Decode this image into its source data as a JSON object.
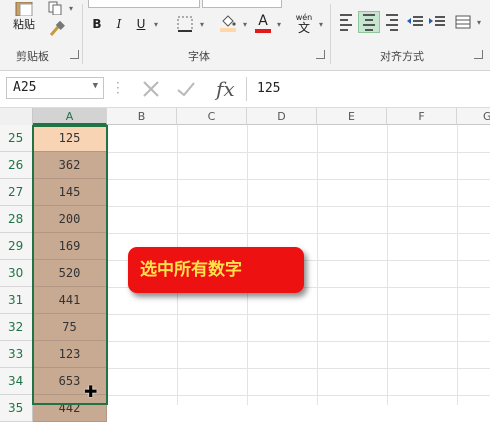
{
  "ribbon": {
    "clipboard": {
      "paste_label": "粘贴",
      "group_label": "剪贴板"
    },
    "font": {
      "bold": "B",
      "italic": "I",
      "underline": "U",
      "font_color_letter": "A",
      "phonetic_top": "wén",
      "phonetic_bottom": "文",
      "group_label": "字体"
    },
    "alignment": {
      "group_label": "对齐方式"
    }
  },
  "formula_bar": {
    "name_box": "A25",
    "formula": "125",
    "fx_label": "fx"
  },
  "sheet": {
    "columns": [
      "A",
      "B",
      "C",
      "D",
      "E",
      "F",
      "G"
    ],
    "selected_column": "A",
    "rows": [
      {
        "num": "25",
        "a": "125"
      },
      {
        "num": "26",
        "a": "362"
      },
      {
        "num": "27",
        "a": "145"
      },
      {
        "num": "28",
        "a": "200"
      },
      {
        "num": "29",
        "a": "169"
      },
      {
        "num": "30",
        "a": "520"
      },
      {
        "num": "31",
        "a": "441"
      },
      {
        "num": "32",
        "a": "75"
      },
      {
        "num": "33",
        "a": "123"
      },
      {
        "num": "34",
        "a": "653"
      },
      {
        "num": "35",
        "a": "442"
      }
    ]
  },
  "callout": {
    "text": "选中所有数字"
  },
  "colors": {
    "selection_fill": "#c8a992",
    "active_cell_fill": "#f8d4b4",
    "selection_border": "#217346",
    "callout_bg": "#ee1111",
    "callout_text": "#ffe14a"
  }
}
